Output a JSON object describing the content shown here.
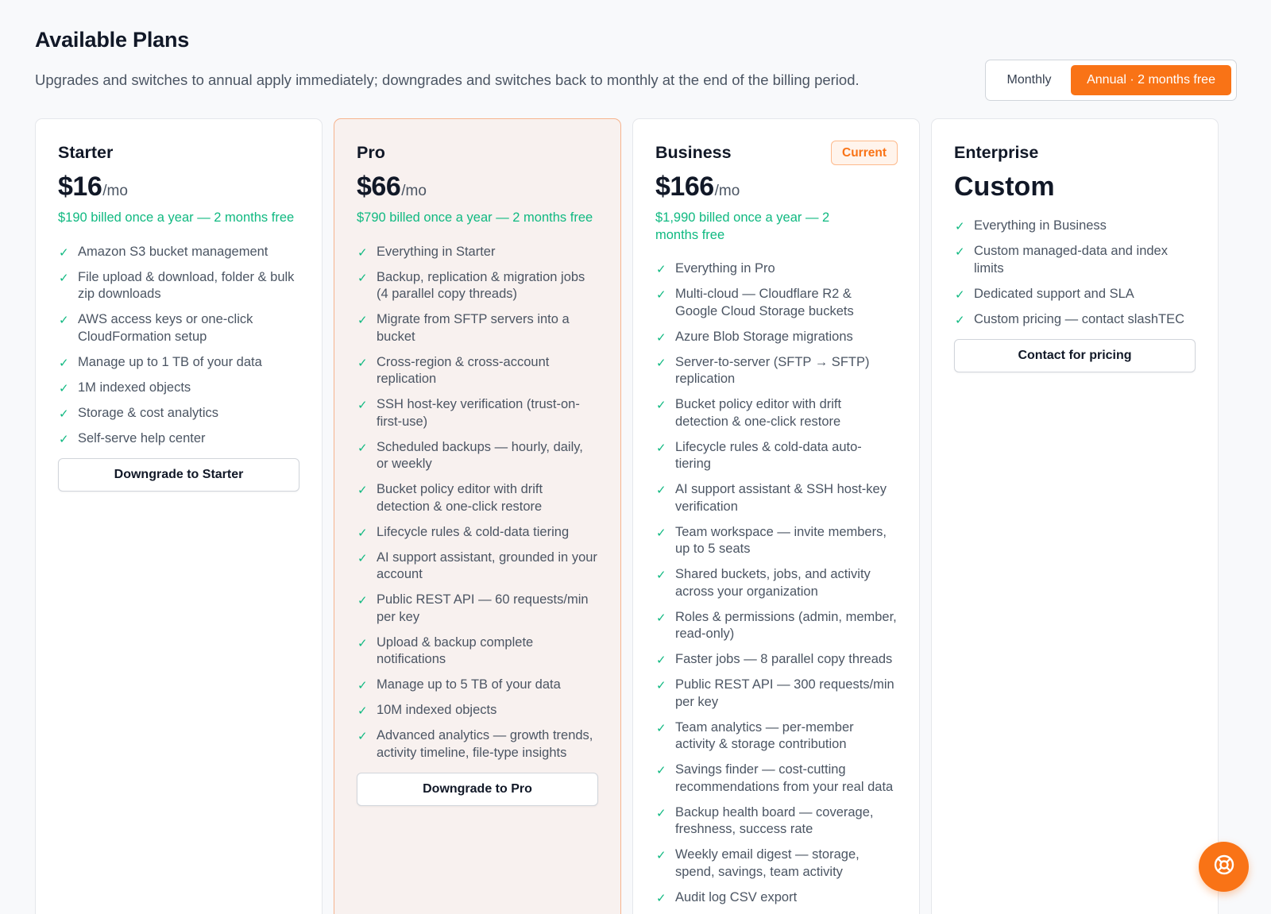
{
  "header": {
    "title": "Available Plans",
    "subtitle": "Upgrades and switches to annual apply immediately; downgrades and switches back to monthly at the end of the billing period."
  },
  "billing_toggle": {
    "monthly_label": "Monthly",
    "annual_label": "Annual · 2 months free",
    "selected": "annual"
  },
  "colors": {
    "accent": "#f97316",
    "success": "#10b981",
    "highlight_card_bg": "#f8f1ef"
  },
  "plans": [
    {
      "name": "Starter",
      "price": "$16",
      "period": "/mo",
      "billed": "$190 billed once a year — 2 months free",
      "features": [
        "Amazon S3 bucket management",
        "File upload & download, folder & bulk zip downloads",
        "AWS access keys or one-click CloudFormation setup",
        "Manage up to 1 TB of your data",
        "1M indexed objects",
        "Storage & cost analytics",
        "Self-serve help center"
      ],
      "cta": "Downgrade to Starter"
    },
    {
      "name": "Pro",
      "price": "$66",
      "period": "/mo",
      "billed": "$790 billed once a year — 2 months free",
      "features": [
        "Everything in Starter",
        "Backup, replication & migration jobs (4 parallel copy threads)",
        "Migrate from SFTP servers into a bucket",
        "Cross-region & cross-account replication",
        "SSH host-key verification (trust-on-first-use)",
        "Scheduled backups — hourly, daily, or weekly",
        "Bucket policy editor with drift detection & one-click restore",
        "Lifecycle rules & cold-data tiering",
        "AI support assistant, grounded in your account",
        "Public REST API — 60 requests/min per key",
        "Upload & backup complete notifications",
        "Manage up to 5 TB of your data",
        "10M indexed objects",
        "Advanced analytics — growth trends, activity timeline, file-type insights"
      ],
      "cta": "Downgrade to Pro"
    },
    {
      "name": "Business",
      "badge": "Current",
      "price": "$166",
      "period": "/mo",
      "billed": "$1,990 billed once a year — 2 months free",
      "features": [
        "Everything in Pro",
        "Multi-cloud — Cloudflare R2 & Google Cloud Storage buckets",
        "Azure Blob Storage migrations",
        "Server-to-server (SFTP → SFTP) replication",
        "Bucket policy editor with drift detection & one-click restore",
        "Lifecycle rules & cold-data auto-tiering",
        "AI support assistant & SSH host-key verification",
        "Team workspace — invite members, up to 5 seats",
        "Shared buckets, jobs, and activity across your organization",
        "Roles & permissions (admin, member, read-only)",
        "Faster jobs — 8 parallel copy threads",
        "Public REST API — 300 requests/min per key",
        "Team analytics — per-member activity & storage contribution",
        "Savings finder — cost-cutting recommendations from your real data",
        "Backup health board — coverage, freshness, success rate",
        "Weekly email digest — storage, spend, savings, team activity",
        "Audit log CSV export"
      ]
    },
    {
      "name": "Enterprise",
      "price": "Custom",
      "features": [
        "Everything in Business",
        "Custom managed-data and index limits",
        "Dedicated support and SLA",
        "Custom pricing — contact slashTEC"
      ],
      "cta": "Contact for pricing"
    }
  ],
  "help_button": {
    "icon": "lifebuoy-icon"
  }
}
